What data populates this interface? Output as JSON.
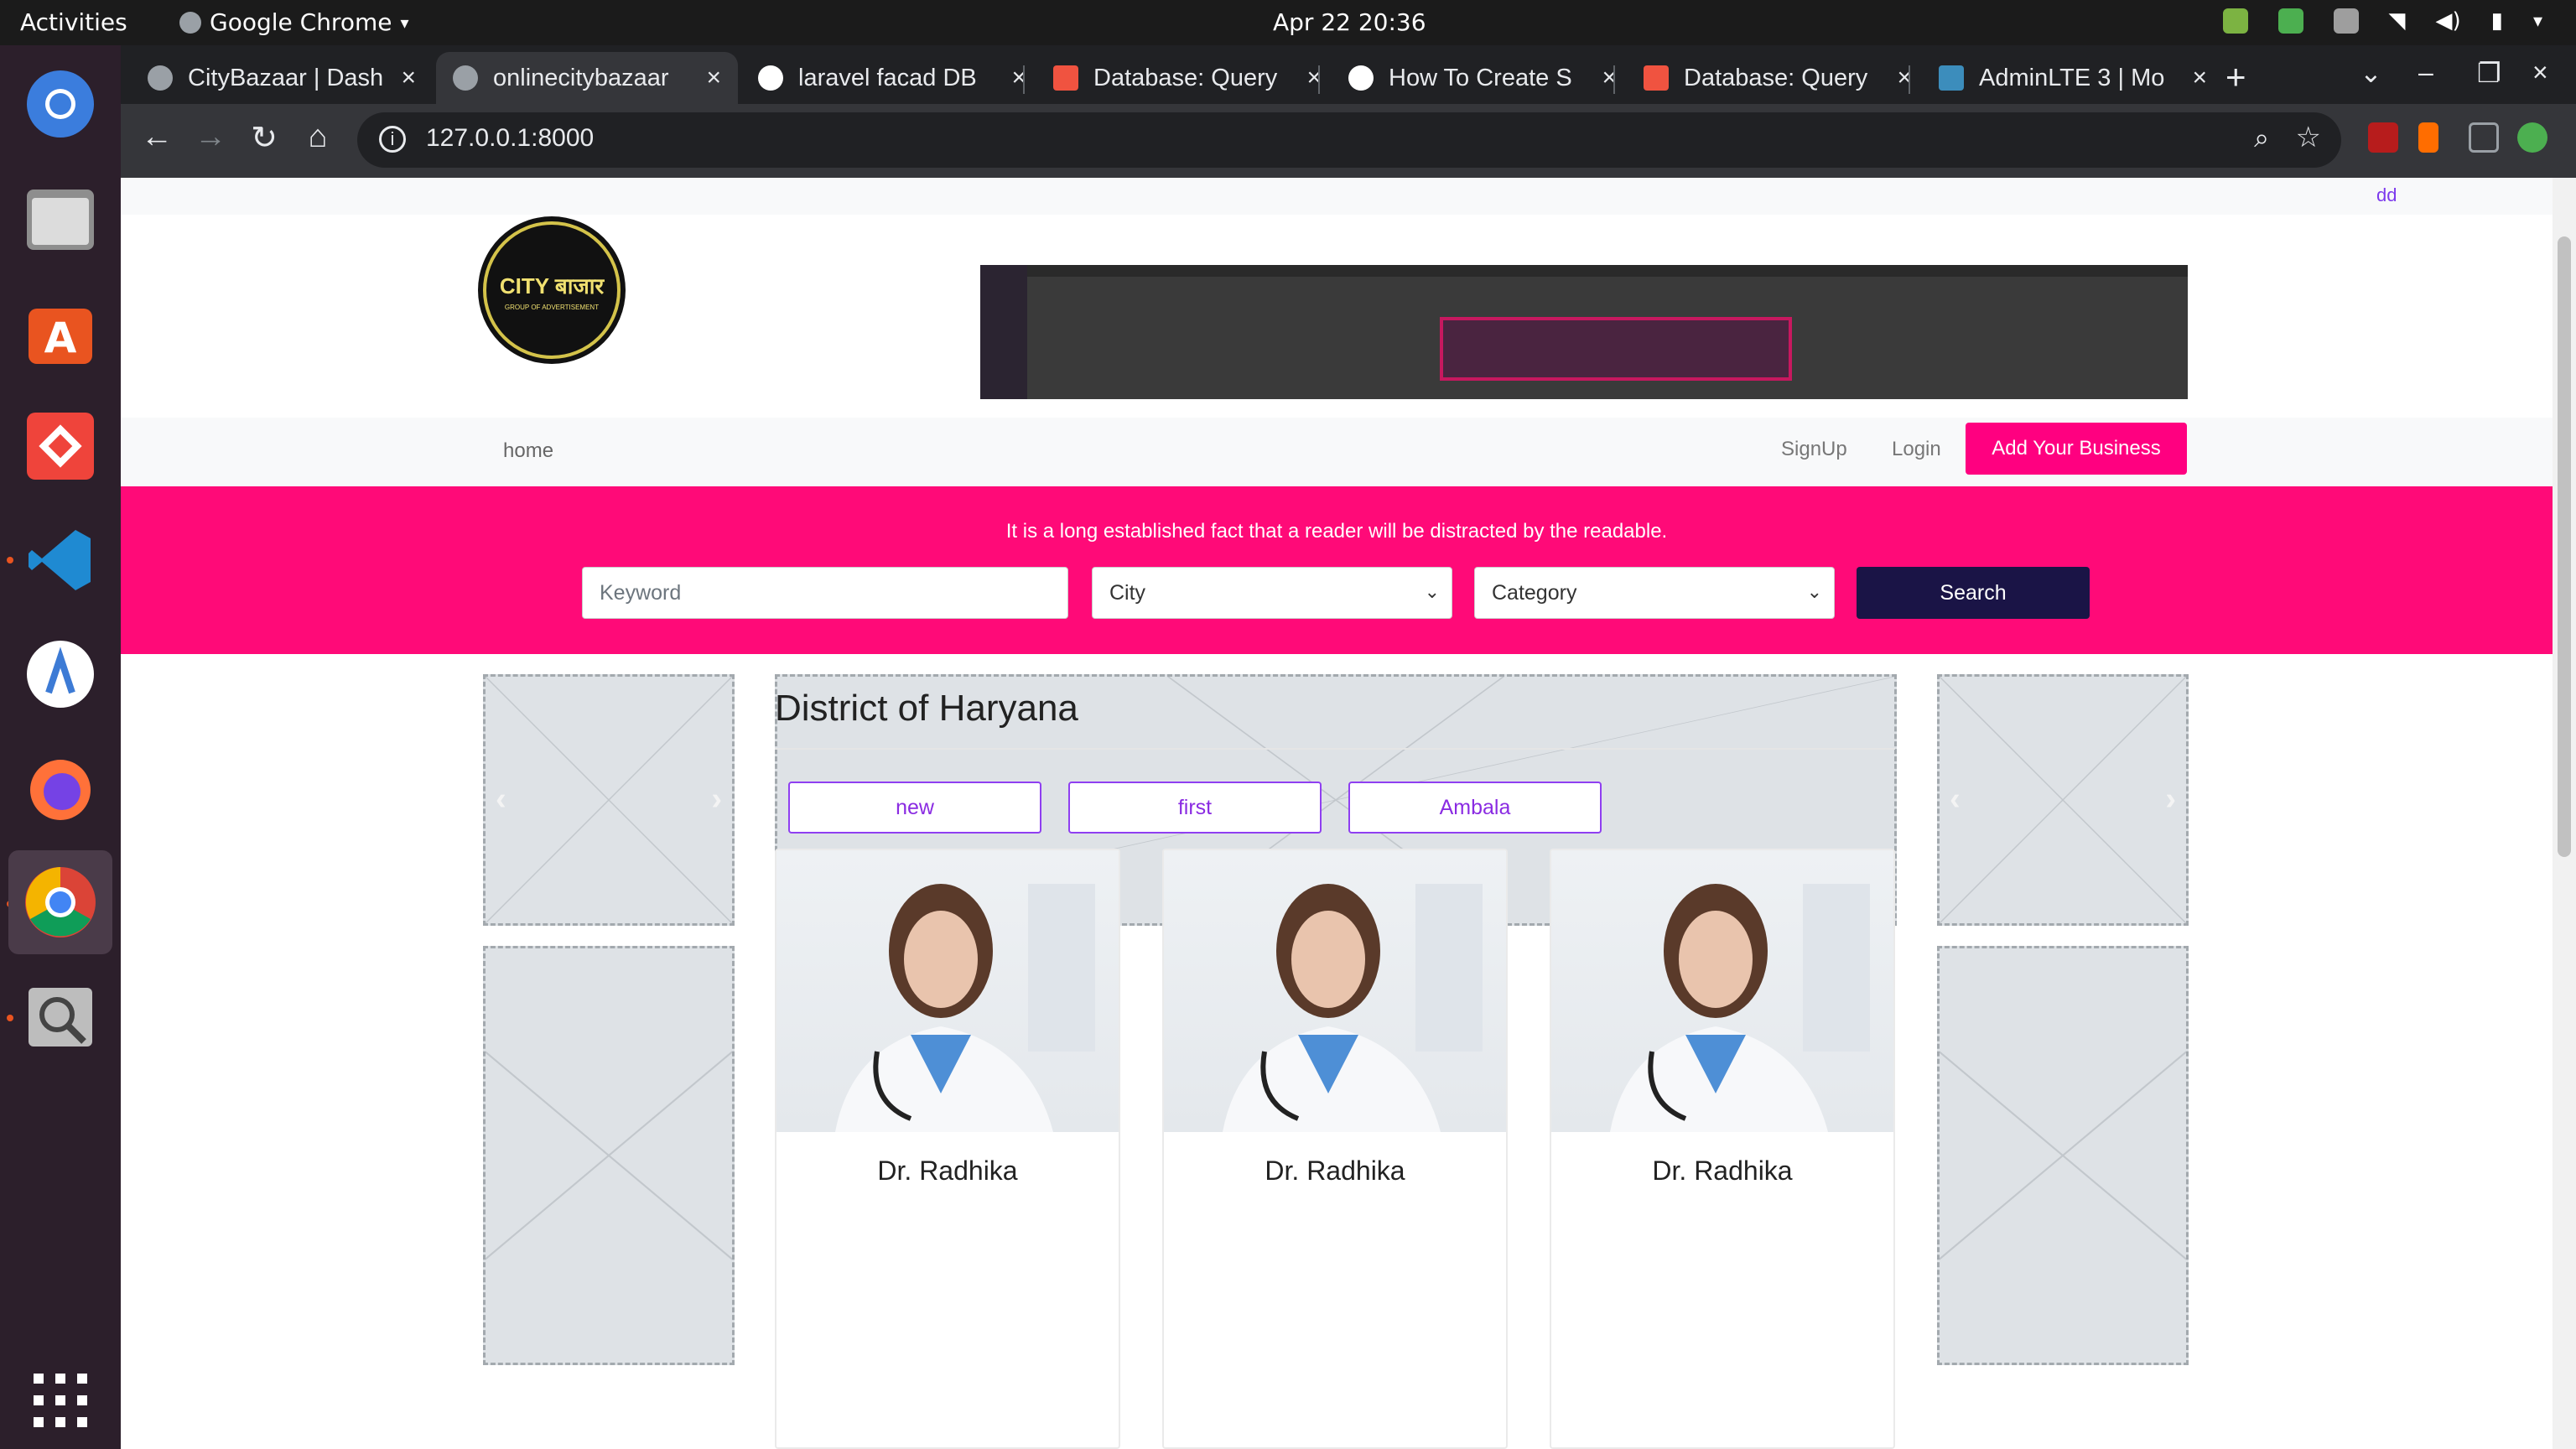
{
  "os": {
    "activities": "Activities",
    "app_name": "Google Chrome",
    "clock": "Apr 22  20:36"
  },
  "browser": {
    "tabs": [
      {
        "title": "CityBazaar | Dash"
      },
      {
        "title": "onlinecitybazaar"
      },
      {
        "title": "laravel facad DB"
      },
      {
        "title": "Database: Query"
      },
      {
        "title": "How To Create S"
      },
      {
        "title": "Database: Query"
      },
      {
        "title": "AdminLTE 3 | Mo"
      }
    ],
    "active_tab_index": 1,
    "url": "127.0.0.1:8000"
  },
  "page": {
    "top_link": "dd",
    "logo": {
      "line1": "CITY बाजार",
      "line2": "GROUP OF ADVERTISEMENT"
    },
    "nav": {
      "home": "home",
      "signup": "SignUp",
      "login": "Login",
      "add_business": "Add Your Business"
    },
    "hero": {
      "tagline": "It is a long established fact that a reader will be distracted by the readable.",
      "keyword_placeholder": "Keyword",
      "city_select": "City",
      "category_select": "Category",
      "search_button": "Search"
    },
    "section_title": "District of Haryana",
    "pills": [
      "new",
      "first",
      "Ambala"
    ],
    "cards": [
      {
        "name": "Dr. Radhika"
      },
      {
        "name": "Dr. Radhika"
      },
      {
        "name": "Dr. Radhika"
      }
    ]
  },
  "colors": {
    "brand_pink": "#ff0a78",
    "search_navy": "#1a1446",
    "pill_purple": "#8a2be2"
  }
}
